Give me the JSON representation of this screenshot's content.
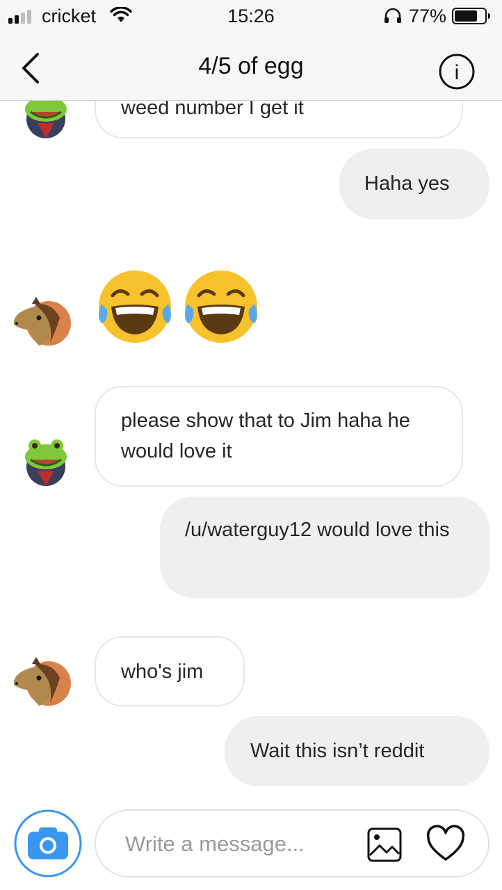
{
  "status_bar": {
    "carrier": "cricket",
    "time": "15:26",
    "battery_percent": "77%",
    "battery_level": 0.77
  },
  "header": {
    "title": "4/5 of egg",
    "info_label": "i"
  },
  "messages": [
    {
      "sender": "frog",
      "direction": "incoming",
      "text": "weed number I get it"
    },
    {
      "sender": "me",
      "direction": "outgoing",
      "text": "Haha yes"
    },
    {
      "sender": "horse",
      "direction": "incoming",
      "emoji": "face-with-tears-of-joy x2"
    },
    {
      "sender": "frog",
      "direction": "incoming",
      "text": "please show that to Jim haha he would love it"
    },
    {
      "sender": "me",
      "direction": "outgoing",
      "text": "/u/waterguy12 would love this"
    },
    {
      "sender": "horse",
      "direction": "incoming",
      "text": "who's jim"
    },
    {
      "sender": "me",
      "direction": "outgoing",
      "text": "Wait this isn’t reddit"
    }
  ],
  "composer": {
    "placeholder": "Write a message..."
  },
  "colors": {
    "accent_blue": "#3897f0",
    "incoming_border": "#e6e6e6",
    "outgoing_bg": "#efefef",
    "text": "#262626"
  }
}
